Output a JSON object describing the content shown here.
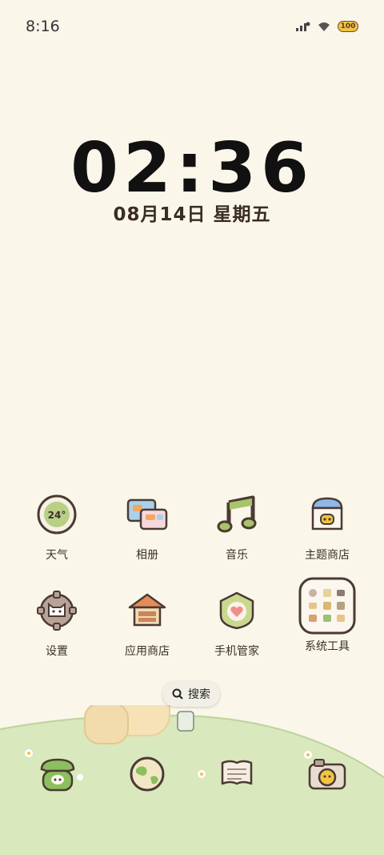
{
  "status_bar": {
    "time": "8:16",
    "battery": "100"
  },
  "lockscreen": {
    "clock": "02:36",
    "date": "08月14日 星期五"
  },
  "apps": [
    {
      "label": "天气",
      "icon": "weather-icon",
      "badge": "24°"
    },
    {
      "label": "相册",
      "icon": "gallery-icon"
    },
    {
      "label": "音乐",
      "icon": "music-icon"
    },
    {
      "label": "主题商店",
      "icon": "theme-store-icon"
    },
    {
      "label": "设置",
      "icon": "settings-icon"
    },
    {
      "label": "应用商店",
      "icon": "app-store-icon"
    },
    {
      "label": "手机管家",
      "icon": "phone-manager-icon"
    },
    {
      "label": "系统工具",
      "icon": "system-tools-folder-icon"
    }
  ],
  "search": {
    "label": "搜索"
  },
  "dock": [
    {
      "icon": "phone-icon"
    },
    {
      "icon": "browser-globe-icon"
    },
    {
      "icon": "messages-icon"
    },
    {
      "icon": "camera-icon"
    }
  ],
  "colors": {
    "background": "#faf6ea",
    "grass": "#d9e8bd",
    "accent_green": "#8cbf5d"
  }
}
